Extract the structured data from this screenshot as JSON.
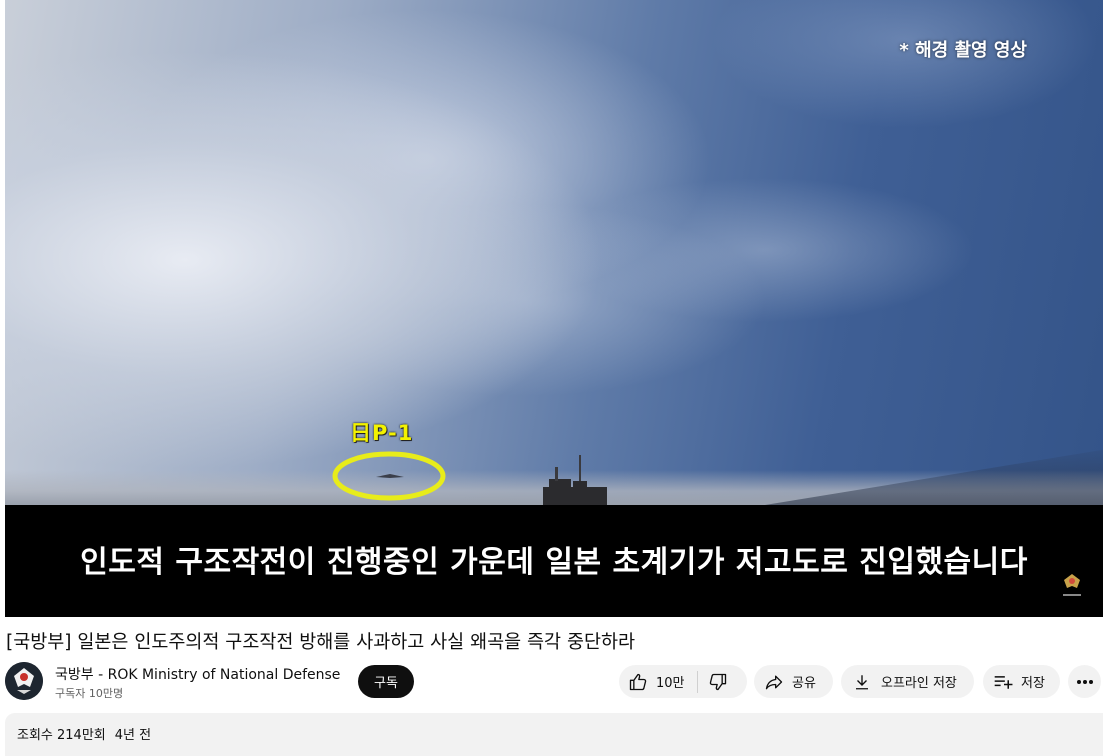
{
  "video": {
    "watermark": "* 해경 촬영 영상",
    "target_label": "日P-1",
    "caption": "인도적 구조작전이 진행중인 가운데 일본 초계기가 저고도로 진입했습니다"
  },
  "title": "[국방부] 일본은 인도주의적 구조작전 방해를 사과하고 사실 왜곡을 즉각 중단하라",
  "channel": {
    "name": "국방부 - ROK Ministry of National Defense",
    "subscribers": "구독자 10만명",
    "subscribe_label": "구독"
  },
  "actions": {
    "like_count": "10만",
    "share_label": "공유",
    "offline_label": "오프라인 저장",
    "save_label": "저장"
  },
  "description": {
    "views": "조회수 214만회",
    "age": "4년 전"
  },
  "colors": {
    "caption_yellow": "#f3f200",
    "subscribe_bg": "#0f0f0f",
    "pill_bg": "#f2f2f2"
  },
  "icons": [
    "like-icon",
    "dislike-icon",
    "share-icon",
    "download-icon",
    "playlist-add-icon",
    "more-icon",
    "mnd-emblem-icon"
  ]
}
